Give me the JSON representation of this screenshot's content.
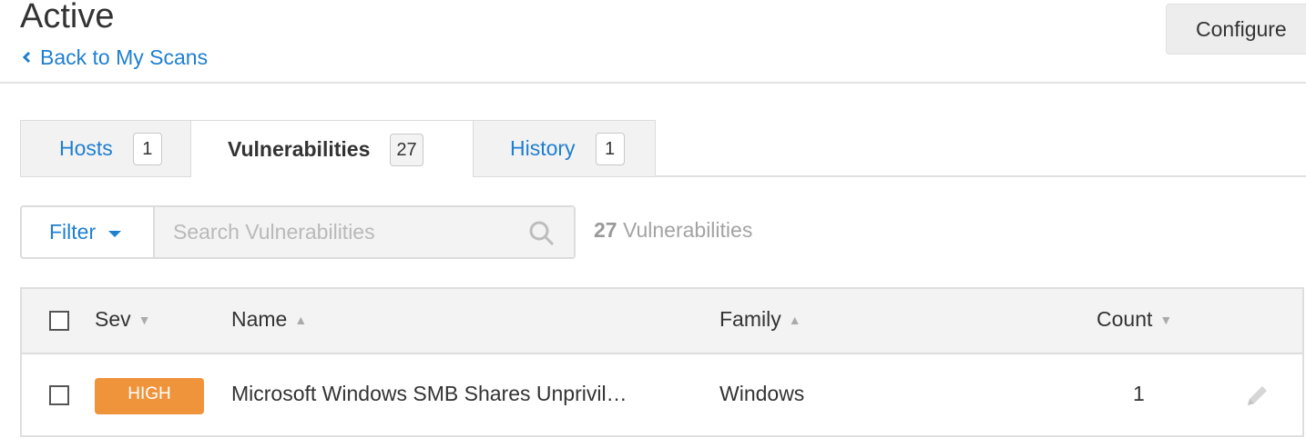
{
  "header": {
    "title": "Active",
    "back_label": "Back to My Scans",
    "configure_label": "Configure"
  },
  "tabs": [
    {
      "label": "Hosts",
      "count": "1",
      "active": false
    },
    {
      "label": "Vulnerabilities",
      "count": "27",
      "active": true
    },
    {
      "label": "History",
      "count": "1",
      "active": false
    }
  ],
  "toolbar": {
    "filter_label": "Filter",
    "search_placeholder": "Search Vulnerabilities",
    "count_number": "27",
    "count_text": " Vulnerabilities"
  },
  "table": {
    "columns": {
      "sev": "Sev",
      "name": "Name",
      "family": "Family",
      "count": "Count"
    },
    "rows": [
      {
        "severity": "HIGH",
        "name": "Microsoft Windows SMB Shares Unprivil…",
        "family": "Windows",
        "count": "1"
      }
    ]
  },
  "colors": {
    "link_blue": "#1f7fd0",
    "high_severity": "#ef943b",
    "header_bg": "#f3f3f3"
  },
  "icons": [
    "chevron-left-icon",
    "caret-down-icon",
    "search-icon",
    "sort-desc-icon",
    "sort-asc-icon",
    "pencil-icon"
  ]
}
